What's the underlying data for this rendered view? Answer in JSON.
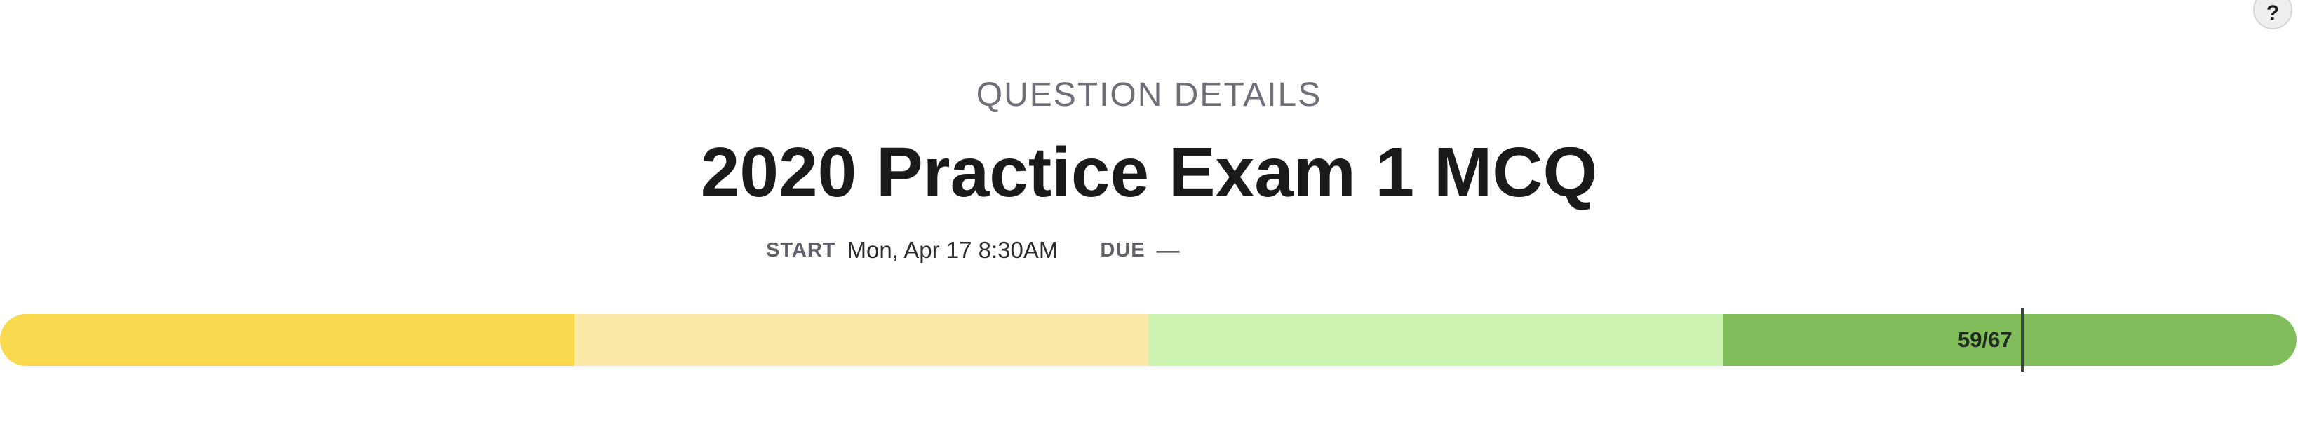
{
  "help": {
    "label": "?"
  },
  "header": {
    "eyebrow": "QUESTION DETAILS",
    "title": "2020 Practice Exam 1 MCQ"
  },
  "meta": {
    "start_label": "START",
    "start_value": "Mon, Apr 17 8:30AM",
    "due_label": "DUE",
    "due_value": "—"
  },
  "progress": {
    "count_label": "59/67",
    "answered": 59,
    "total": 67,
    "segment_colors": [
      "#f9da4f",
      "#fae9a8",
      "#ccf3b2",
      "#82bd5c"
    ]
  }
}
